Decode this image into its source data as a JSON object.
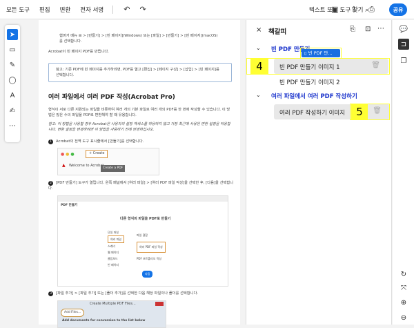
{
  "menu": {
    "all_tools": "모든 도구",
    "edit": "편집",
    "convert": "변환",
    "esign": "전자 서명",
    "search": "텍스트 또는 도구 찾기",
    "share": "공유"
  },
  "doc": {
    "p1": "햄버거 메뉴 ☰ > [만들기] > [빈 페이지](Windows) 또는 [파일] > [만들기] > [빈 페이지](macOS)를 선택합니다.",
    "p2": "Acrobat이 빈 페이지 PDF를 만듭니다.",
    "note": "참고: 기존 PDF에 빈 페이지를 추가하려면, PDF를 열고 [편집] > [페이지 구성] > [삽입] > [빈 페이지]를 선택합니다.",
    "heading": "여러 파일에서 여러 PDF 작성(Acrobat Pro)",
    "p3": "형식이 서로 다른 지원되는 파일을 비롯하여 여러 개의 기본 파일로 여러 개의 PDF를 한 번에 작성할 수 있습니다. 이 방법은 많은 수의 파일을 PDF로 변환해야 할 때 유용합니다.",
    "p4": "참고: 이 방법을 사용할 경우 Acrobat은 사용자의 설정 액세스를 허용하지 않고 가장 최근에 사용된 변환 설정을 적용합니다. 변환 설정을 변경하려면 이 방법을 사용하기 전에 변경하십시오.",
    "steps": [
      {
        "n": "1",
        "text": "Acrobat의 전역 도구 표시줄에서 [만들기]를 선택합니다."
      },
      {
        "n": "2",
        "text": "[PDF 만들기] 도구가 열립니다. 왼쪽 패널에서 [여러 파일] > [여러 PDF 파일 작성]을 선택한 후, [다음]을 선택합니다."
      },
      {
        "n": "3",
        "text": "[파일 추가] > [파일 추가] 또는 [폴더 추가]를 선택한 다음 해당 파일이나 폴더를 선택합니다."
      }
    ],
    "img1": {
      "create": "+ Create",
      "welcome": "Welcome to Acrobat",
      "tooltip": "Create a PDF"
    },
    "img2": {
      "title": "PDF 만들기",
      "heading": "다른 형식의 파일을 PDF로 만들기",
      "left": [
        "단일 파일",
        "여러 파일",
        "스캐너",
        "웹 페이지",
        "클립보드",
        "빈 페이지"
      ],
      "opts": [
        "파일 결합",
        "여러 PDF 파일 작성",
        "PDF 포트폴리오 작성"
      ],
      "next": "다음"
    },
    "img3": {
      "title": "Create Multiple PDF Files...",
      "add": "Add Files...",
      "desc": "Add documents for conversion to the list below"
    }
  },
  "panel": {
    "title": "책갈피",
    "drag_chip": "빈 PDF 만...",
    "groups": [
      {
        "label": "빈 PDF 만들기",
        "items": [
          "빈 PDF 만들기 이미지 1",
          "빈 PDF 만들기 이미지 2"
        ]
      },
      {
        "label": "여러 파일에서 여러 PDF 작성하기",
        "items": [
          "여러 PDF 작성하기 이미지"
        ]
      }
    ],
    "callouts": [
      "4",
      "5"
    ]
  }
}
